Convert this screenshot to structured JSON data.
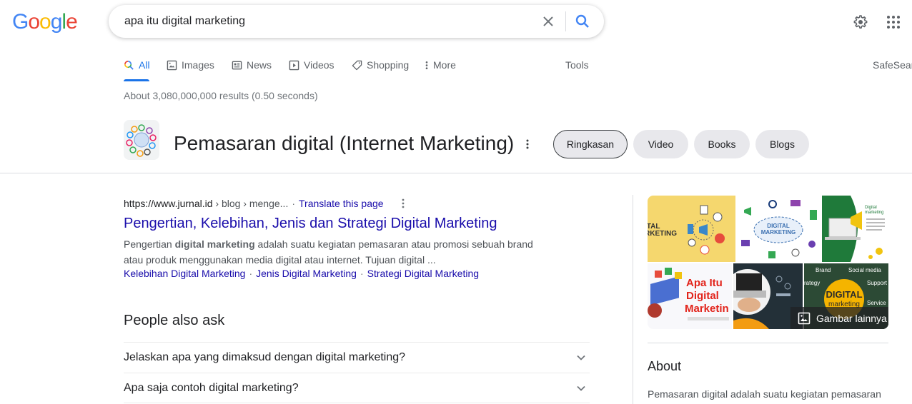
{
  "logo": {
    "letters": [
      "G",
      "o",
      "o",
      "g",
      "l",
      "e"
    ],
    "colors": [
      "#4285f4",
      "#ea4335",
      "#fbbc05",
      "#4285f4",
      "#34a853",
      "#ea4335"
    ]
  },
  "search": {
    "query": "apa itu digital marketing",
    "clear_icon": "close-icon",
    "search_icon": "search-icon"
  },
  "header": {
    "settings_icon": "gear-icon",
    "apps_icon": "apps-grid-icon"
  },
  "tabs": [
    {
      "label": "All",
      "icon": "search-icon",
      "active": true
    },
    {
      "label": "Images",
      "icon": "image-icon"
    },
    {
      "label": "News",
      "icon": "news-icon"
    },
    {
      "label": "Videos",
      "icon": "play-icon"
    },
    {
      "label": "Shopping",
      "icon": "tag-icon"
    },
    {
      "label": "More",
      "icon": "more-vert-icon"
    }
  ],
  "tools_label": "Tools",
  "safesearch_label": "SafeSear",
  "result_stats": "About 3,080,000,000 results (0.50 seconds)",
  "entity": {
    "title": "Pemasaran digital (Internet Marketing)",
    "chips": [
      "Ringkasan",
      "Video",
      "Books",
      "Blogs"
    ],
    "selected_chip": "Ringkasan"
  },
  "result": {
    "domain": "https://www.jurnal.id",
    "path": "› blog › menge...",
    "translate": "Translate this page",
    "title": "Pengertian, Kelebihan, Jenis dan Strategi Digital Marketing",
    "snippet_pre": "Pengertian ",
    "snippet_bold": "digital marketing",
    "snippet_post": " adalah suatu kegiatan pemasaran atau promosi sebuah brand atau produk menggunakan media digital atau internet. Tujuan digital ...",
    "sitelinks": [
      "Kelebihan Digital Marketing",
      "Jenis Digital Marketing",
      "Strategi Digital Marketing"
    ]
  },
  "people_also_ask": {
    "title": "People also ask",
    "questions": [
      "Jelaskan apa yang dimaksud dengan digital marketing?",
      "Apa saja contoh digital marketing?"
    ]
  },
  "knowledge_panel": {
    "images": [
      {
        "caption": "ITAL RKETING"
      },
      {
        "caption": "DIGITAL MARKETING"
      },
      {
        "caption": "Digital marketing"
      },
      {
        "caption": "Apa Itu Digital Marketing"
      },
      {
        "caption": ""
      },
      {
        "caption": "DIGITAL marketing"
      }
    ],
    "more_images_label": "Gambar lainnya",
    "about_title": "About",
    "about_text": "Pemasaran digital adalah suatu kegiatan pemasaran"
  }
}
